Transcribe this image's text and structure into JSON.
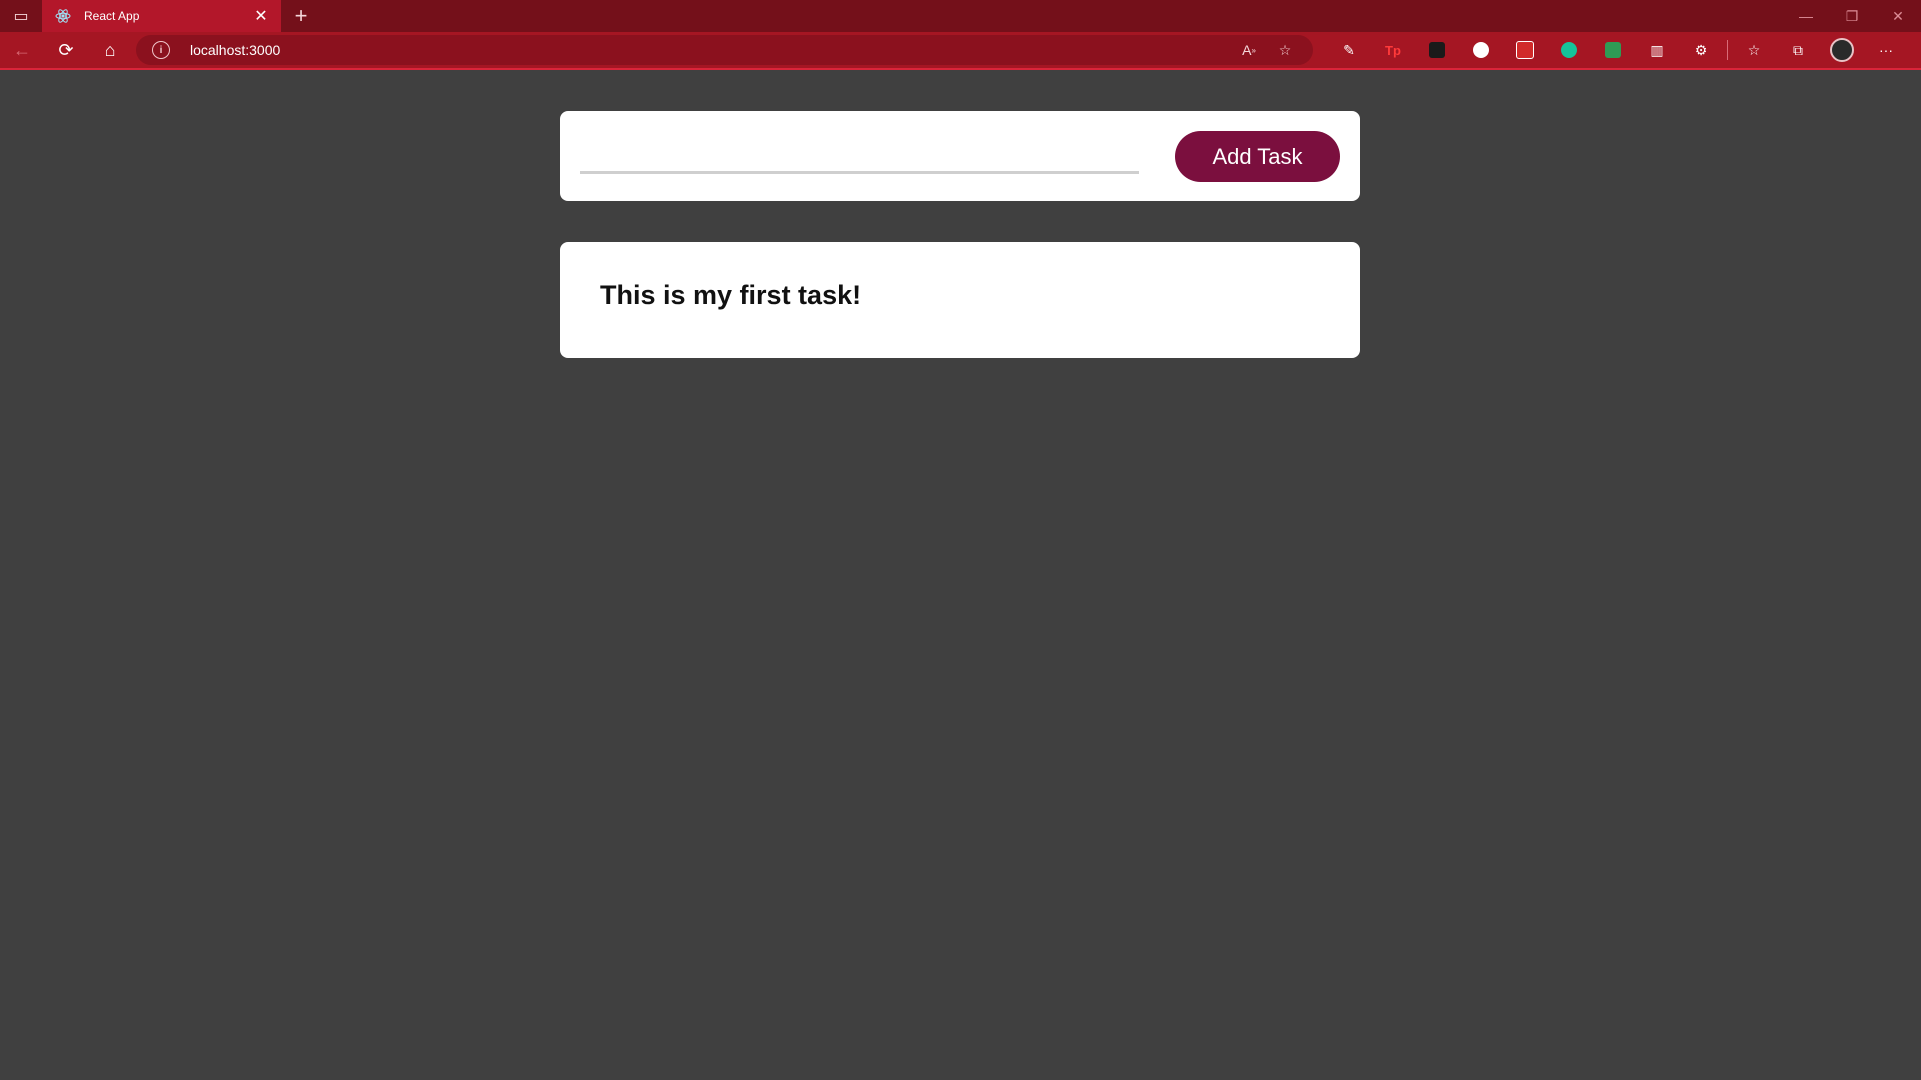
{
  "browser": {
    "tab_title": "React App",
    "url": "localhost:3000",
    "accent_color": "#a51623"
  },
  "form": {
    "input_value": "",
    "input_placeholder": "",
    "add_label": "Add Task",
    "button_color": "#7b0f3e"
  },
  "tasks": [
    {
      "text": "This is my first task!"
    }
  ],
  "extensions": [
    "pen-icon",
    "tp-icon",
    "hat-icon",
    "circle-icon",
    "puzzle-red-icon",
    "grammarly-icon",
    "flag-icon",
    "chart-icon",
    "extensions-icon",
    "favorites-icon",
    "collections-icon",
    "profile-avatar",
    "more-icon"
  ]
}
